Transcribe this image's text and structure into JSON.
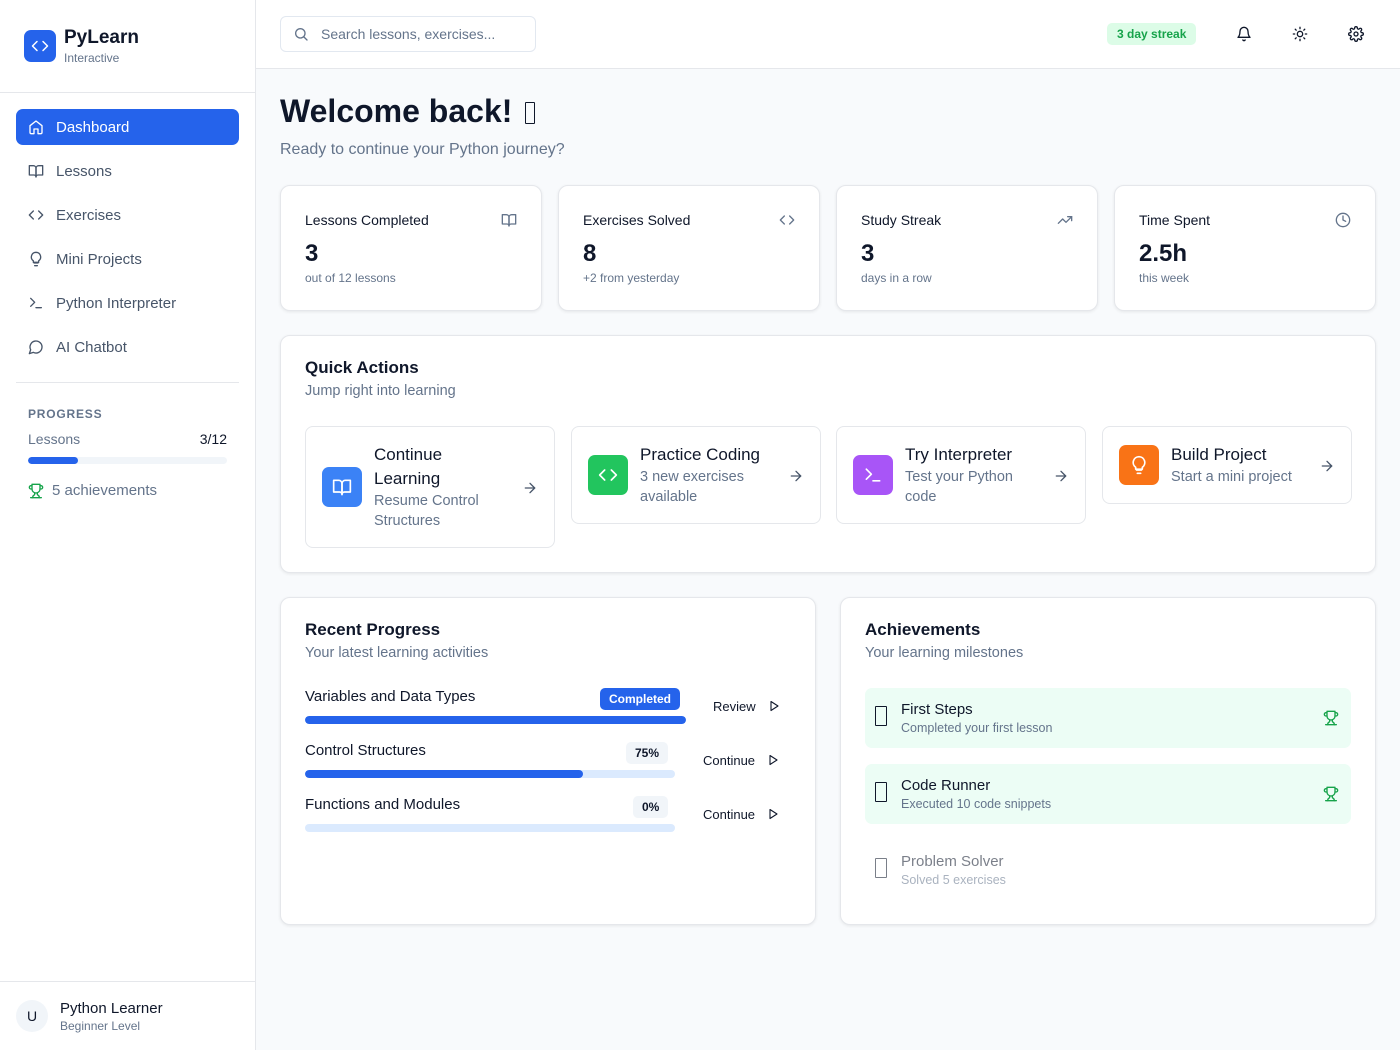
{
  "brand": {
    "name": "PyLearn",
    "subtitle": "Interactive"
  },
  "nav": [
    {
      "label": "Dashboard",
      "icon": "home-icon",
      "active": true
    },
    {
      "label": "Lessons",
      "icon": "book-icon"
    },
    {
      "label": "Exercises",
      "icon": "code-icon"
    },
    {
      "label": "Mini Projects",
      "icon": "lightbulb-icon"
    },
    {
      "label": "Python Interpreter",
      "icon": "terminal-icon"
    },
    {
      "label": "AI Chatbot",
      "icon": "chat-icon"
    }
  ],
  "sidebar_progress": {
    "title": "PROGRESS",
    "label": "Lessons",
    "value": "3/12",
    "fraction": 0.25,
    "achievements": "5 achievements"
  },
  "user": {
    "initial": "U",
    "name": "Python Learner",
    "level": "Beginner Level"
  },
  "topbar": {
    "search_placeholder": "Search lessons, exercises...",
    "streak": "3 day streak"
  },
  "welcome": {
    "title": "Welcome back! ",
    "subtitle": "Ready to continue your Python journey?"
  },
  "stats": [
    {
      "title": "Lessons Completed",
      "value": "3",
      "sub": "out of 12 lessons",
      "icon": "book-icon"
    },
    {
      "title": "Exercises Solved",
      "value": "8",
      "sub": "+2 from yesterday",
      "icon": "code-icon"
    },
    {
      "title": "Study Streak",
      "value": "3",
      "sub": "days in a row",
      "icon": "trending-up-icon"
    },
    {
      "title": "Time Spent",
      "value": "2.5h",
      "sub": "this week",
      "icon": "clock-icon"
    }
  ],
  "quick_actions": {
    "title": "Quick Actions",
    "subtitle": "Jump right into learning",
    "items": [
      {
        "title": "Continue Learning",
        "sub": "Resume Control Structures",
        "icon": "book-icon",
        "color": "#3b82f6"
      },
      {
        "title": "Practice Coding",
        "sub": "3 new exercises available",
        "icon": "code-icon",
        "color": "#22c55e"
      },
      {
        "title": "Try Interpreter",
        "sub": "Test your Python code",
        "icon": "terminal-icon",
        "color": "#a855f7"
      },
      {
        "title": "Build Project",
        "sub": "Start a mini project",
        "icon": "lightbulb-icon",
        "color": "#f97316"
      }
    ]
  },
  "recent_progress": {
    "title": "Recent Progress",
    "subtitle": "Your latest learning activities",
    "items": [
      {
        "name": "Variables and Data Types",
        "badge": "Completed",
        "progress": 1.0,
        "action": "Review"
      },
      {
        "name": "Control Structures",
        "badge": "75%",
        "progress": 0.75,
        "action": "Continue"
      },
      {
        "name": "Functions and Modules",
        "badge": "0%",
        "progress": 0.0,
        "action": "Continue"
      }
    ]
  },
  "achievements": {
    "title": "Achievements",
    "subtitle": "Your learning milestones",
    "items": [
      {
        "name": "First Steps",
        "desc": "Completed your first lesson",
        "earned": true
      },
      {
        "name": "Code Runner",
        "desc": "Executed 10 code snippets",
        "earned": true
      },
      {
        "name": "Problem Solver",
        "desc": "Solved 5 exercises",
        "earned": false
      }
    ]
  },
  "colors": {
    "primary": "#2563eb",
    "success": "#16a34a",
    "muted": "#64748b"
  }
}
